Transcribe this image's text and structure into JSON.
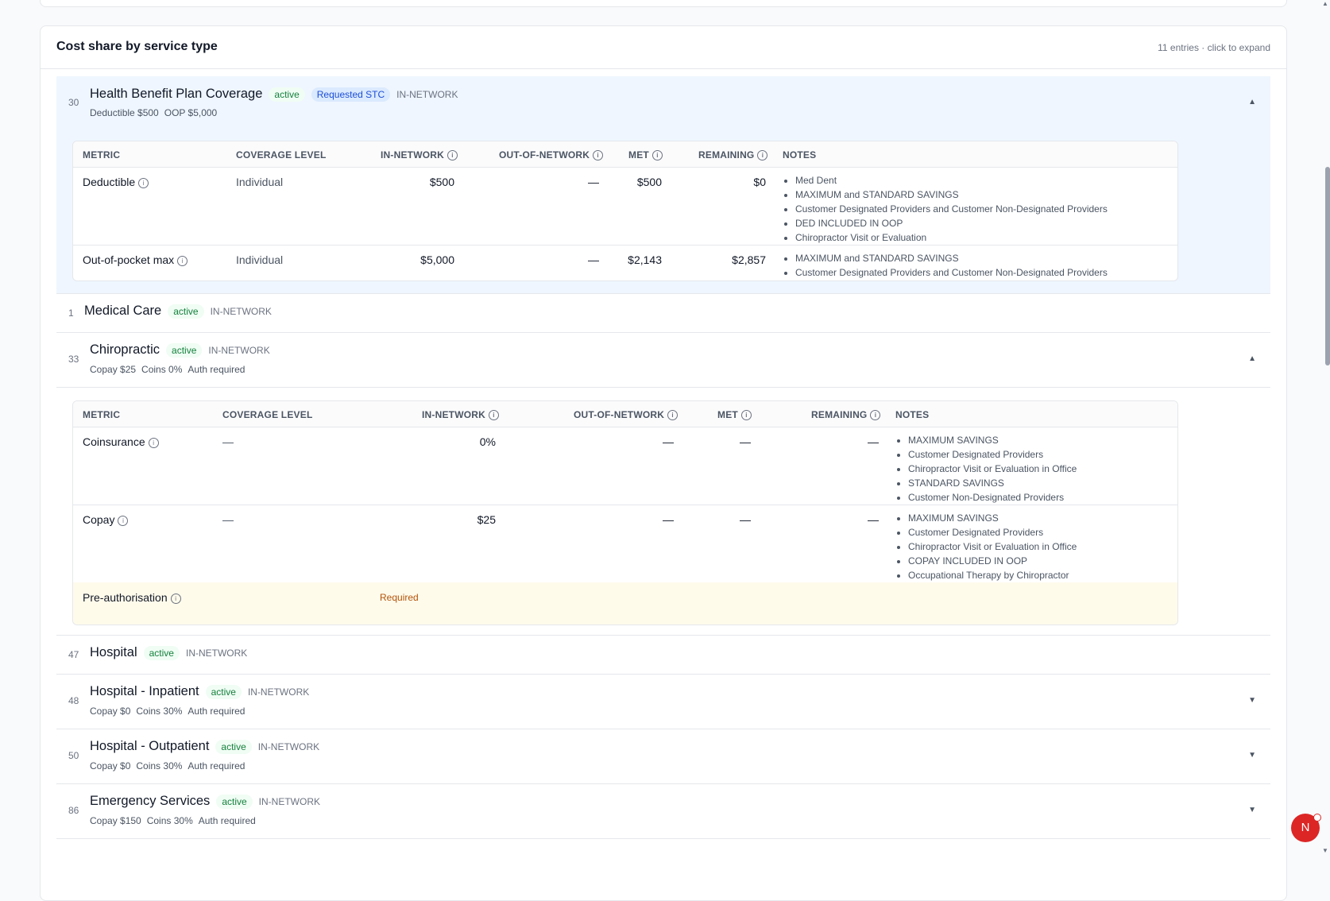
{
  "section": {
    "title": "Cost share by service type",
    "meta": "11 entries · click to expand"
  },
  "entries": [
    {
      "num": "30",
      "name": "Health Benefit Plan Coverage",
      "status": "active",
      "badge": "Requested STC",
      "network": "IN-NETWORK",
      "summary": [
        "Deductible $500",
        "OOP $5,000"
      ],
      "chevron": "▲",
      "table": {
        "headers": [
          "METRIC",
          "COVERAGE LEVEL",
          "IN-NETWORK",
          "OUT-OF-NETWORK",
          "MET",
          "REMAINING",
          "NOTES"
        ],
        "rows": [
          {
            "metric": "Deductible",
            "level": "Individual",
            "in": "$500",
            "out": "—",
            "met": "$500",
            "remaining": "$0",
            "notes": [
              "Med Dent",
              "MAXIMUM and STANDARD SAVINGS",
              "Customer Designated Providers and Customer Non-Designated Providers",
              "DED INCLUDED IN OOP",
              "Chiropractor Visit or Evaluation"
            ]
          },
          {
            "metric": "Out-of-pocket max",
            "level": "Individual",
            "in": "$5,000",
            "out": "—",
            "met": "$2,143",
            "remaining": "$2,857",
            "notes": [
              "MAXIMUM and STANDARD SAVINGS",
              "Customer Designated Providers and Customer Non-Designated Providers"
            ]
          }
        ]
      }
    },
    {
      "num": "1",
      "name": "Medical Care",
      "status": "active",
      "network": "IN-NETWORK"
    },
    {
      "num": "33",
      "name": "Chiropractic",
      "status": "active",
      "network": "IN-NETWORK",
      "summary": [
        "Copay $25",
        "Coins 0%",
        "Auth required"
      ],
      "chevron": "▲",
      "table": {
        "headers": [
          "METRIC",
          "COVERAGE LEVEL",
          "IN-NETWORK",
          "OUT-OF-NETWORK",
          "MET",
          "REMAINING",
          "NOTES"
        ],
        "rows": [
          {
            "metric": "Coinsurance",
            "level": "—",
            "in": "0%",
            "out": "—",
            "met": "—",
            "remaining": "—",
            "notes": [
              "MAXIMUM SAVINGS",
              "Customer Designated Providers",
              "Chiropractor Visit or Evaluation in Office",
              "STANDARD SAVINGS",
              "Customer Non-Designated Providers"
            ]
          },
          {
            "metric": "Copay",
            "level": "—",
            "in": "$25",
            "out": "—",
            "met": "—",
            "remaining": "—",
            "notes": [
              "MAXIMUM SAVINGS",
              "Customer Designated Providers",
              "Chiropractor Visit or Evaluation in Office",
              "COPAY INCLUDED IN OOP",
              "Occupational Therapy by Chiropractor"
            ]
          }
        ],
        "preauth": {
          "label": "Pre-authorisation",
          "value": "Required"
        }
      }
    },
    {
      "num": "47",
      "name": "Hospital",
      "status": "active",
      "network": "IN-NETWORK"
    },
    {
      "num": "48",
      "name": "Hospital - Inpatient",
      "status": "active",
      "network": "IN-NETWORK",
      "summary": [
        "Copay $0",
        "Coins 30%",
        "Auth required"
      ],
      "chevron": "▼"
    },
    {
      "num": "50",
      "name": "Hospital - Outpatient",
      "status": "active",
      "network": "IN-NETWORK",
      "summary": [
        "Copay $0",
        "Coins 30%",
        "Auth required"
      ],
      "chevron": "▼"
    },
    {
      "num": "86",
      "name": "Emergency Services",
      "status": "active",
      "network": "IN-NETWORK",
      "summary": [
        "Copay $150",
        "Coins 30%",
        "Auth required"
      ],
      "chevron": "▼"
    }
  ],
  "avatar": {
    "initial": "N"
  },
  "colors": {
    "accent": "#1d4ed8",
    "active": "#15803d",
    "required": "#b45309",
    "avatar": "#dc2626"
  }
}
